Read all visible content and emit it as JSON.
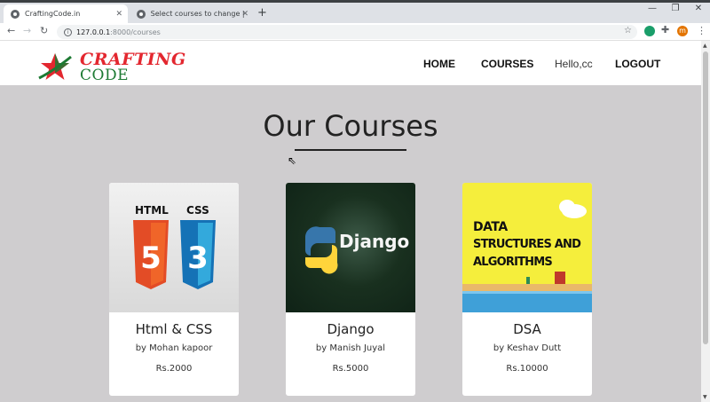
{
  "browser": {
    "tabs": [
      {
        "title": "CraftingCode.in",
        "active": true
      },
      {
        "title": "Select courses to change | Djang",
        "active": false
      }
    ],
    "url_host": "127.0.0.1",
    "url_path": ":8000/courses",
    "profile_initial": "m"
  },
  "site": {
    "logo_line1": "CRAFTING",
    "logo_line2": "CODE",
    "nav": {
      "home": "HOME",
      "courses": "COURSES",
      "greeting": "Hello,cc",
      "logout": "LOGOUT"
    }
  },
  "page": {
    "heading": "Our Courses"
  },
  "courses": [
    {
      "title": "Html & CSS",
      "author": "by Mohan kapoor",
      "price": "Rs.2000",
      "image": "html-css-logo",
      "img_text1": "HTML",
      "img_text2": "CSS"
    },
    {
      "title": "Django",
      "author": "by Manish Juyal",
      "price": "Rs.5000",
      "image": "django-python-logo",
      "img_text1": "Django"
    },
    {
      "title": "DSA",
      "author": "by Keshav Dutt",
      "price": "Rs.10000",
      "image": "dsa-banner",
      "img_text1": "DATA",
      "img_text2": "STRUCTURES AND",
      "img_text3": "ALGORITHMS"
    }
  ],
  "colors": {
    "page_bg": "#cfcdcf",
    "logo_red": "#e3272f",
    "logo_green": "#1d7a33"
  }
}
